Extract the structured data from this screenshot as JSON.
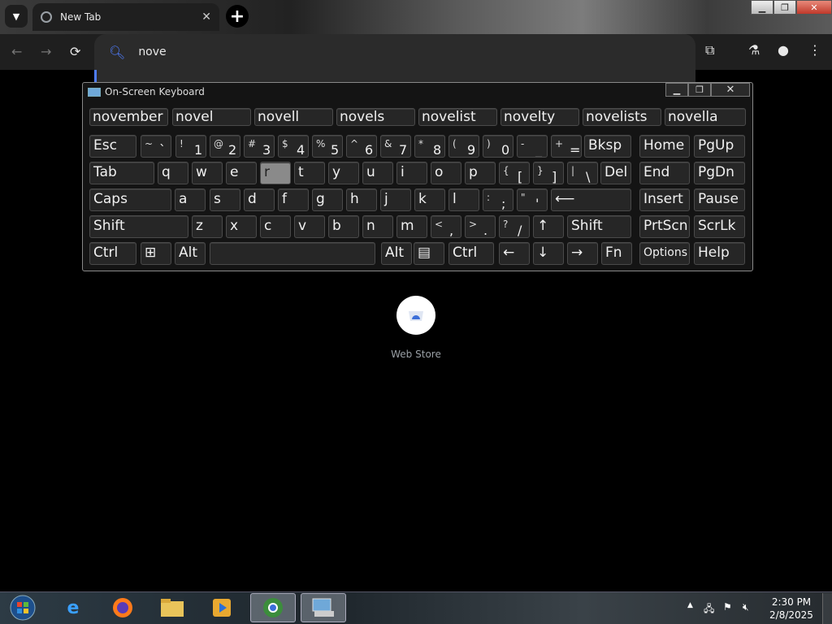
{
  "browser": {
    "tab_title": "New Tab",
    "tab_close": "✕",
    "new_tab": "+",
    "omnibox_text": "nove",
    "back": "←",
    "forward": "→",
    "reload": "⟳",
    "extensions_icon": "⧉",
    "labs_icon": "⚗",
    "profile_icon": "●",
    "menu_icon": "⋮"
  },
  "window_controls": {
    "minimize": "▁",
    "maximize": "❐",
    "close": "✕"
  },
  "osk": {
    "title": "On-Screen Keyboard",
    "predictions": [
      "november",
      "novel",
      "novell",
      "novels",
      "novelist",
      "novelty",
      "novelists",
      "novella"
    ],
    "row1": [
      {
        "k": "Esc"
      },
      {
        "s": "~",
        "m": "`"
      },
      {
        "s": "!",
        "m": "1"
      },
      {
        "s": "@",
        "m": "2"
      },
      {
        "s": "#",
        "m": "3"
      },
      {
        "s": "$",
        "m": "4"
      },
      {
        "s": "%",
        "m": "5"
      },
      {
        "s": "^",
        "m": "6"
      },
      {
        "s": "&",
        "m": "7"
      },
      {
        "s": "*",
        "m": "8"
      },
      {
        "s": "(",
        "m": "9"
      },
      {
        "s": ")",
        "m": "0"
      },
      {
        "s": "-",
        "m": "_"
      },
      {
        "s": "+",
        "m": "="
      },
      {
        "k": "Bksp"
      },
      {
        "k": "Home"
      },
      {
        "k": "PgUp"
      }
    ],
    "row2": [
      {
        "k": "Tab"
      },
      {
        "k": "q"
      },
      {
        "k": "w"
      },
      {
        "k": "e"
      },
      {
        "k": "r"
      },
      {
        "k": "t"
      },
      {
        "k": "y"
      },
      {
        "k": "u"
      },
      {
        "k": "i"
      },
      {
        "k": "o"
      },
      {
        "k": "p"
      },
      {
        "s": "{",
        "m": "["
      },
      {
        "s": "}",
        "m": "]"
      },
      {
        "s": "|",
        "m": "\\"
      },
      {
        "k": "Del"
      },
      {
        "k": "End"
      },
      {
        "k": "PgDn"
      }
    ],
    "row3": [
      {
        "k": "Caps"
      },
      {
        "k": "a"
      },
      {
        "k": "s"
      },
      {
        "k": "d"
      },
      {
        "k": "f"
      },
      {
        "k": "g"
      },
      {
        "k": "h"
      },
      {
        "k": "j"
      },
      {
        "k": "k"
      },
      {
        "k": "l"
      },
      {
        "s": ":",
        "m": ";"
      },
      {
        "s": "\"",
        "m": "'"
      },
      {
        "k": "⟵"
      },
      {
        "k": "Insert"
      },
      {
        "k": "Pause"
      }
    ],
    "row4": [
      {
        "k": "Shift"
      },
      {
        "k": "z"
      },
      {
        "k": "x"
      },
      {
        "k": "c"
      },
      {
        "k": "v"
      },
      {
        "k": "b"
      },
      {
        "k": "n"
      },
      {
        "k": "m"
      },
      {
        "s": "<",
        "m": ","
      },
      {
        "s": ">",
        "m": "."
      },
      {
        "s": "?",
        "m": "/"
      },
      {
        "k": "↑"
      },
      {
        "k": "Shift"
      },
      {
        "k": "PrtScn"
      },
      {
        "k": "ScrLk"
      }
    ],
    "row5": [
      {
        "k": "Ctrl"
      },
      {
        "k": "⊞"
      },
      {
        "k": "Alt"
      },
      {
        "k": ""
      },
      {
        "k": "Alt"
      },
      {
        "k": "▤"
      },
      {
        "k": "Ctrl"
      },
      {
        "k": "←"
      },
      {
        "k": "↓"
      },
      {
        "k": "→"
      },
      {
        "k": "Fn"
      },
      {
        "k": "Options"
      },
      {
        "k": "Help"
      }
    ],
    "pressed_key": "r"
  },
  "newtab": {
    "shortcut_label": "Web Store"
  },
  "taskbar": {
    "start_icon": "windows-start-icon",
    "apps": [
      "internet-explorer-icon",
      "firefox-icon",
      "file-explorer-icon",
      "media-player-icon",
      "chrome-icon",
      "on-screen-keyboard-icon"
    ],
    "tray_arrow": "▲",
    "time": "2:30 PM",
    "date": "2/8/2025"
  }
}
